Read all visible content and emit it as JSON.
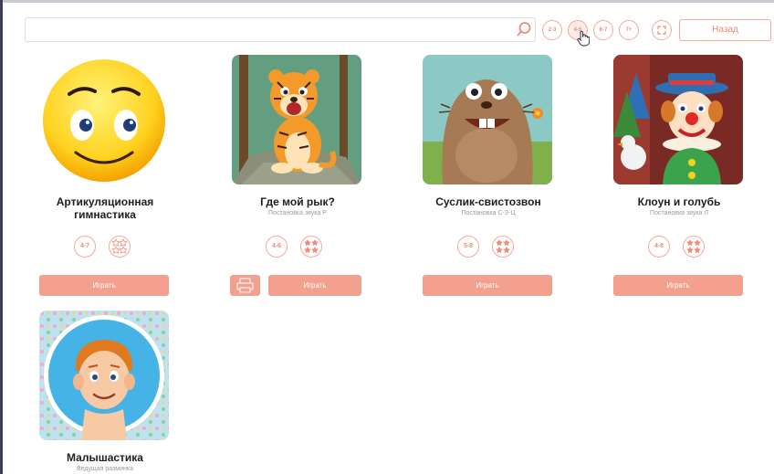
{
  "toolbar": {
    "search_value": "",
    "age_filters": [
      "2-3",
      "4-5",
      "6-7",
      "7+"
    ],
    "active_filter": "4-5",
    "back_label": "Назад"
  },
  "games": [
    {
      "title": "Артикуляционная гимнастика",
      "subtitle": "",
      "age": "4-7",
      "difficulty": "outline-stars",
      "play_label": "Играть",
      "has_print": false
    },
    {
      "title": "Где мой рык?",
      "subtitle": "Постановка звука Р",
      "age": "4-6",
      "difficulty": "filled-stars",
      "play_label": "Играть",
      "has_print": true
    },
    {
      "title": "Суслик-свистозвон",
      "subtitle": "Постановка С-З-Ц",
      "age": "5-8",
      "difficulty": "filled-stars",
      "play_label": "Играть",
      "has_print": false
    },
    {
      "title": "Клоун и голубь",
      "subtitle": "Постановка звука Л",
      "age": "4-8",
      "difficulty": "filled-stars",
      "play_label": "Играть",
      "has_print": false
    },
    {
      "title": "Малышастика",
      "subtitle": "Ведущая разминка",
      "age": "",
      "difficulty": "",
      "play_label": "",
      "has_print": false
    }
  ],
  "colors": {
    "accent": "#f3a08f",
    "accent_text": "#ee8b7a"
  }
}
